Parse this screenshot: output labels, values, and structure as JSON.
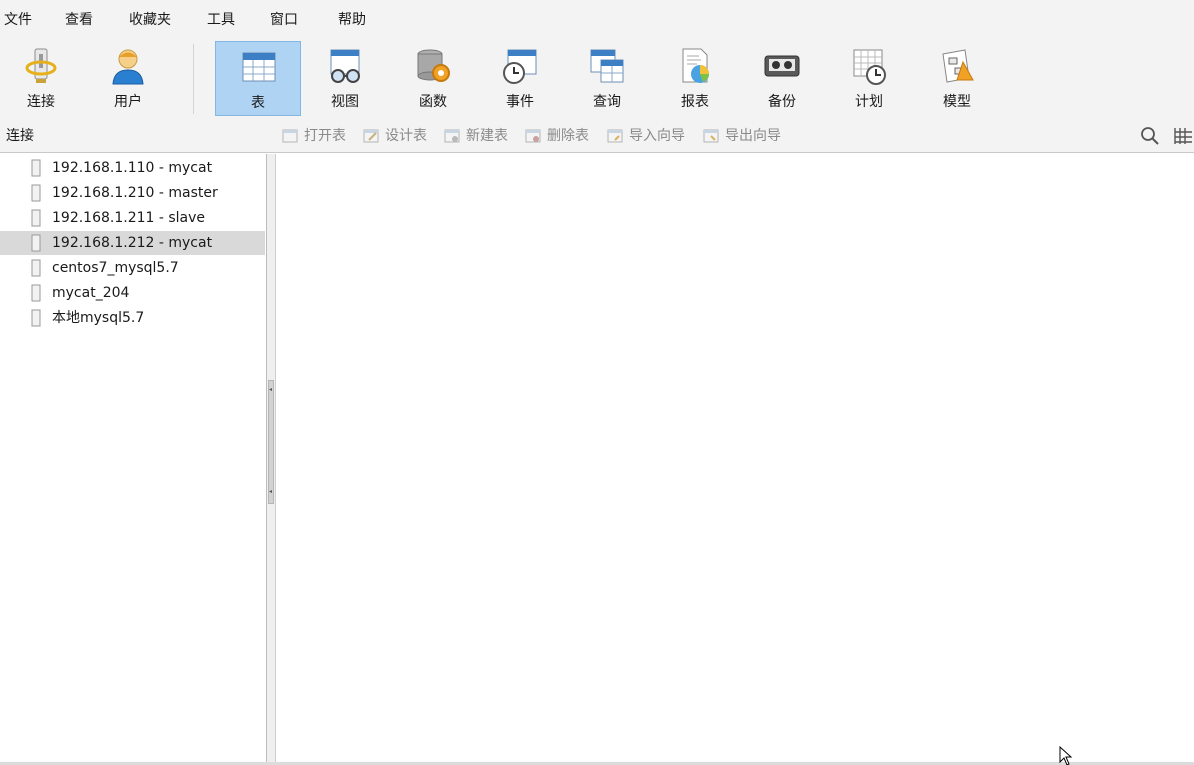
{
  "menu": {
    "file": "文件",
    "view": "查看",
    "favorites": "收藏夹",
    "tools": "工具",
    "window": "窗口",
    "help": "帮助"
  },
  "toolbar": {
    "connect": "连接",
    "user": "用户",
    "table": "表",
    "view": "视图",
    "function": "函数",
    "event": "事件",
    "query": "查询",
    "report": "报表",
    "backup": "备份",
    "schedule": "计划",
    "model": "模型",
    "active_item": "表"
  },
  "subbar": {
    "panel_title": "连接",
    "open_table": "打开表",
    "design_table": "设计表",
    "new_table": "新建表",
    "delete_table": "删除表",
    "import_wizard": "导入向导",
    "export_wizard": "导出向导"
  },
  "connections": [
    {
      "label": "192.168.1.110 - mycat",
      "selected": false
    },
    {
      "label": "192.168.1.210 - master",
      "selected": false
    },
    {
      "label": "192.168.1.211 - slave",
      "selected": false
    },
    {
      "label": "192.168.1.212 - mycat",
      "selected": true
    },
    {
      "label": "centos7_mysql5.7",
      "selected": false
    },
    {
      "label": "mycat_204",
      "selected": false
    },
    {
      "label": "本地mysql5.7",
      "selected": false
    }
  ],
  "colors": {
    "chrome_bg": "#f3f3f3",
    "active_tool_bg": "#aed3f3",
    "selected_row_bg": "#d9d9d9",
    "disabled_text": "#8a8a8a"
  }
}
